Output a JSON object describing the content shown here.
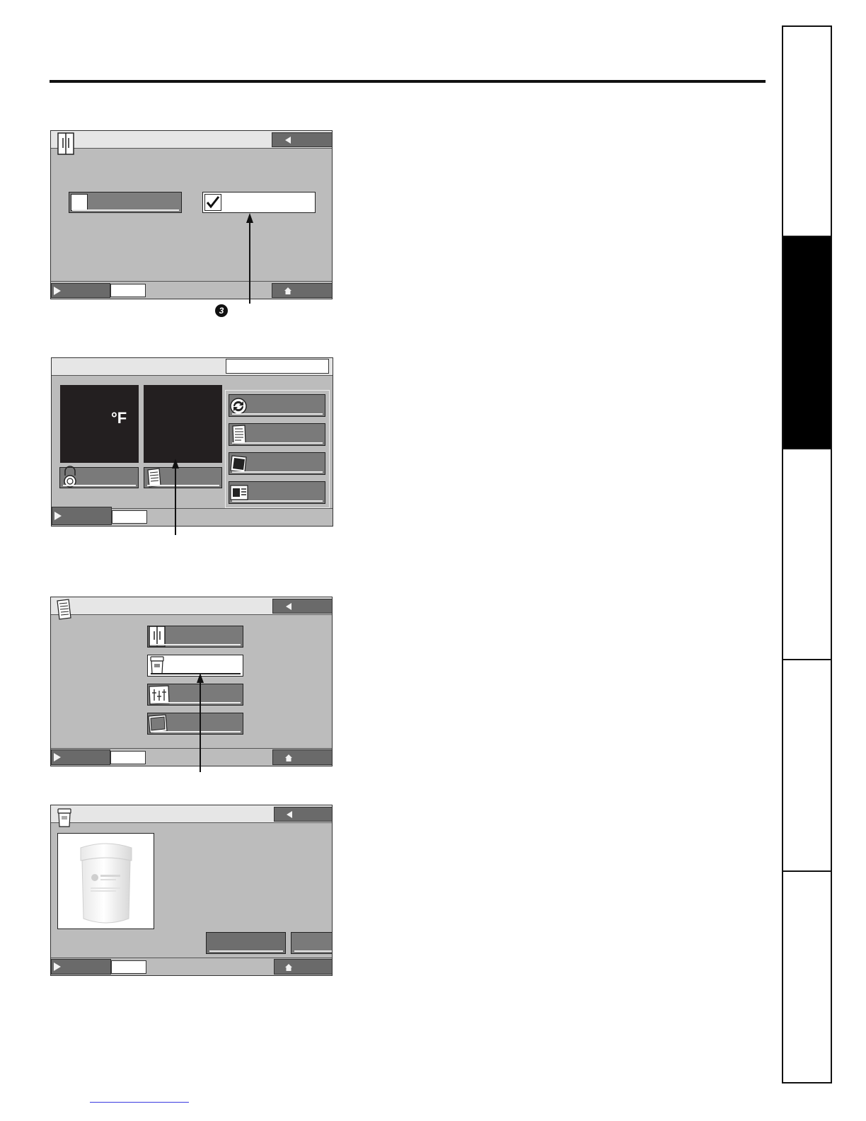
{
  "screens": {
    "water_filter_setting": {
      "checkbox_option_1": {
        "checked": false
      },
      "checkbox_option_2": {
        "checked": true
      },
      "callout_number": "3",
      "icons": [
        "fridge-icon",
        "back-arrow-icon",
        "play-icon",
        "home-icon"
      ]
    },
    "home_screen": {
      "freezer_temp_unit": "°F",
      "icons": [
        "refresh-icon",
        "notes-icon",
        "photo-icon",
        "display-icon",
        "lock-icon",
        "settings-notes-icon",
        "play-icon"
      ]
    },
    "settings_menu": {
      "icons": [
        "notes-icon",
        "back-arrow-icon",
        "fridge-icon",
        "water-filter-icon",
        "adjust-icon",
        "screen-icon",
        "play-icon",
        "home-icon"
      ]
    },
    "water_filter_info": {
      "product_image": "smartwater-filter",
      "icons": [
        "water-filter-icon",
        "back-arrow-icon",
        "play-icon",
        "home-icon"
      ]
    }
  },
  "side_tabs": {
    "active_index": 1,
    "count": 5
  }
}
